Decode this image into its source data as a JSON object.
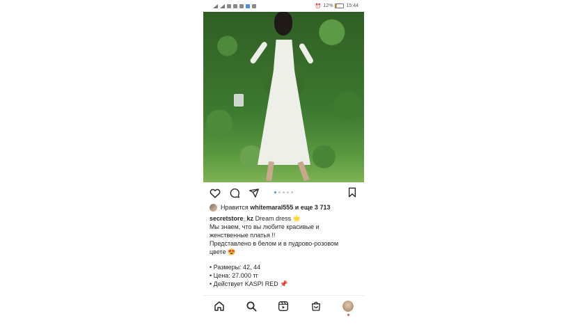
{
  "status_bar": {
    "battery": "12%",
    "time": "15:44"
  },
  "post": {
    "carousel": {
      "count": 5,
      "active_index": 0
    },
    "likes": {
      "prefix": "Нравится",
      "user": "whitemaral555",
      "suffix": "и еще 3 713"
    },
    "caption": {
      "author": "secretstore_kz",
      "title": "Dream dress 🌟",
      "lines": [
        "Мы знаем, что вы любите красивые и",
        "женственные платья !!",
        "Представлено в белом и в пудрово-розовом",
        "цвете 😍",
        "• Размеры: 42, 44",
        "• Цена: 27.000 тг",
        "• Действует KASPI RED 📌"
      ]
    }
  },
  "icons": {
    "like": "heart-icon",
    "comment": "comment-icon",
    "share": "share-icon",
    "save": "bookmark-icon",
    "home": "home-icon",
    "search": "search-icon",
    "reels": "reels-icon",
    "shop": "shop-icon",
    "profile": "profile-avatar"
  },
  "colors": {
    "accent": "#3897f0",
    "notification": "#ed4956"
  }
}
